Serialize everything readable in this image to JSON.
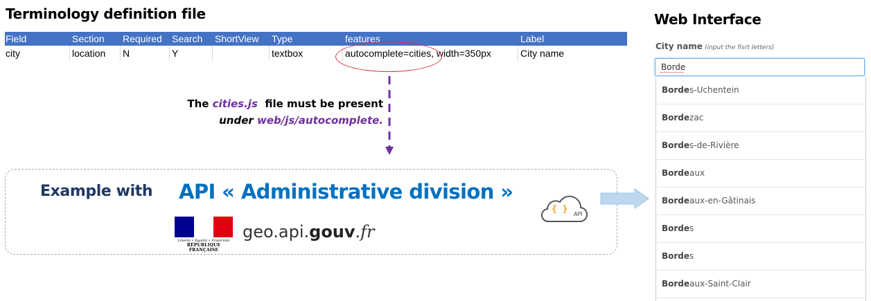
{
  "left_title": "Terminology definition file",
  "sheet": {
    "headers": [
      "Field",
      "Section",
      "Required",
      "Search",
      "ShortView",
      "Type",
      "features",
      "Label"
    ],
    "row": [
      "city",
      "location",
      "N",
      "Y",
      "",
      "textbox",
      "autocomplete=cities, width=350px",
      "City name"
    ]
  },
  "note": {
    "line1_pre": "The ",
    "line1_file": "cities.js",
    "line1_post": "  file must be present",
    "line2_pre": "under ",
    "line2_path": "web/js/autocomplete."
  },
  "api_box": {
    "example_label": "Example with",
    "api_title": "API « Administrative division »",
    "rf_motto": "Liberté • Égalité • Fraternité",
    "rf_name": "RÉPUBLIQUE FRANÇAISE",
    "geo_prefix": "geo.api.",
    "geo_bold": "gouv",
    "geo_suffix": ".fr",
    "cloud_braces": "{ }",
    "cloud_label": "API"
  },
  "web": {
    "title": "Web Interface",
    "field_label": "City name",
    "field_hint": "(input the fisrt letters)",
    "input_value": "Borde",
    "suggestions": [
      {
        "match": "Borde",
        "rest": "s-Uchentein"
      },
      {
        "match": "Borde",
        "rest": "zac"
      },
      {
        "match": "Borde",
        "rest": "s-de-Rivière"
      },
      {
        "match": "Borde",
        "rest": "aux"
      },
      {
        "match": "Borde",
        "rest": "aux-en-Gâtinais"
      },
      {
        "match": "Borde",
        "rest": "s"
      },
      {
        "match": "Borde",
        "rest": "s"
      },
      {
        "match": "Borde",
        "rest": "aux-Saint-Clair"
      }
    ]
  },
  "colors": {
    "header_blue": "#4472c4",
    "ellipse_red": "#d9303f",
    "note_purple": "#7030a0",
    "example_navy": "#1f3864",
    "api_blue": "#0070c0",
    "input_focus": "#66afe9"
  }
}
